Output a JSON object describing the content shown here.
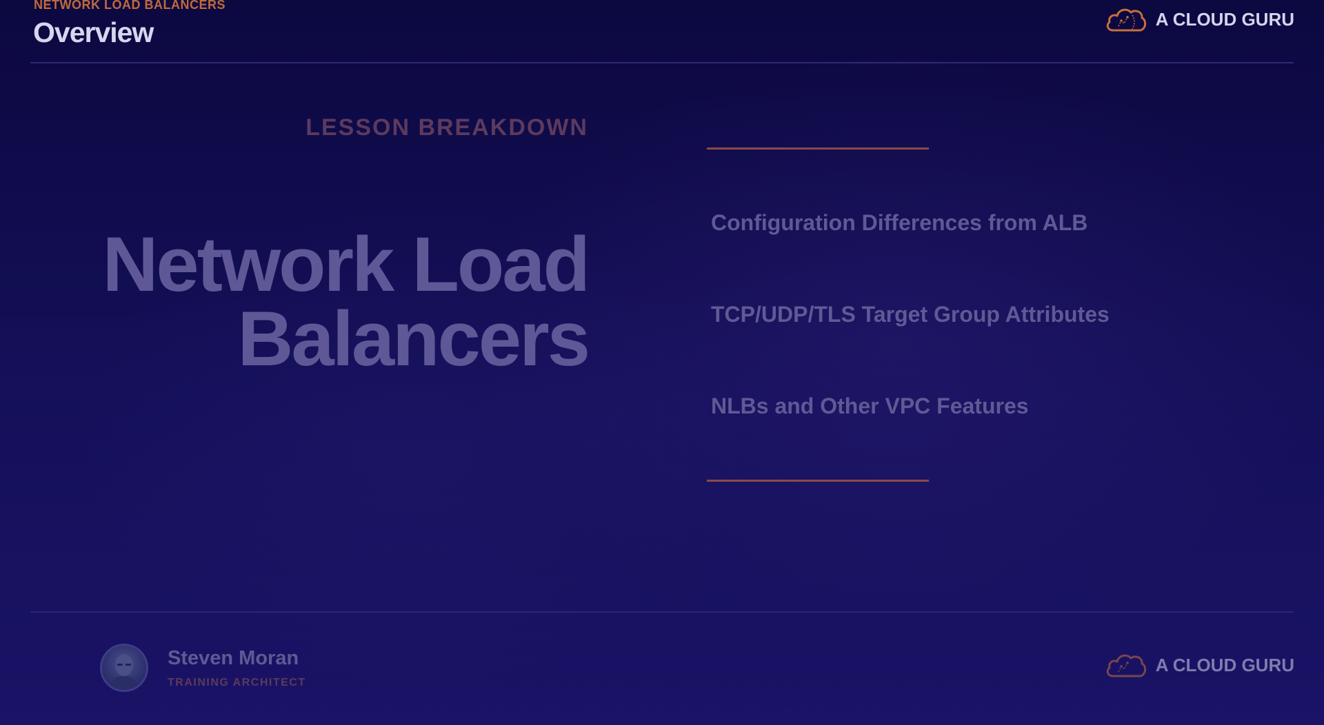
{
  "header": {
    "eyebrow": "NETWORK LOAD BALANCERS",
    "title": "Overview"
  },
  "brand": {
    "name": "A CLOUD GURU",
    "icon": "cloud-icon",
    "icon_color": "#c8703a"
  },
  "main": {
    "section_label": "LESSON BREAKDOWN",
    "title_line_1": "Network Load",
    "title_line_2": "Balancers",
    "topics": [
      "Configuration Differences from ALB",
      "TCP/UDP/TLS Target Group Attributes",
      "NLBs and Other VPC Features"
    ]
  },
  "presenter": {
    "name": "Steven Moran",
    "role": "TRAINING ARCHITECT"
  },
  "colors": {
    "background": "#130d52",
    "accent": "#c06a3c",
    "text_light": "#d6d6ee"
  }
}
